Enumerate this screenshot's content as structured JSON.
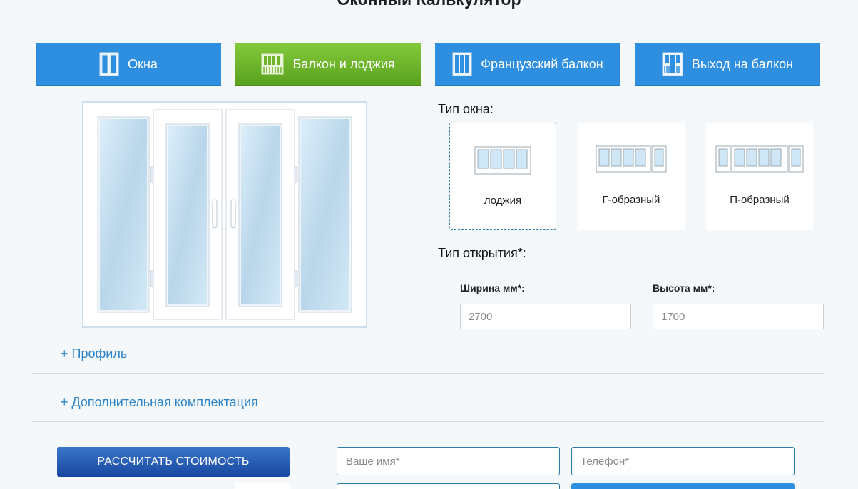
{
  "page": {
    "title": "Оконный Калькулятор"
  },
  "tabs": [
    {
      "label": "Окна",
      "icon": "window-icon",
      "active": false
    },
    {
      "label": "Балкон и лоджия",
      "icon": "balcony-icon",
      "active": true
    },
    {
      "label": "Французский балкон",
      "icon": "french-balcony-icon",
      "active": false
    },
    {
      "label": "Выход на балкон",
      "icon": "balcony-door-icon",
      "active": false
    }
  ],
  "window_type": {
    "title": "Тип окна:",
    "options": [
      {
        "label": "лоджия",
        "selected": true
      },
      {
        "label": "Г-образный",
        "selected": false
      },
      {
        "label": "П-образный",
        "selected": false
      }
    ]
  },
  "opening_type": {
    "title": "Тип открытия",
    "required_mark": "*",
    "suffix": ":"
  },
  "dimensions": {
    "width": {
      "label": "Ширина мм",
      "required_mark": "*",
      "suffix": ":",
      "placeholder": "2700"
    },
    "height": {
      "label": "Высота мм",
      "required_mark": "*",
      "suffix": ":",
      "placeholder": "1700"
    }
  },
  "expanders": {
    "profile": "+ Профиль",
    "extras": "+ Дополнительная комплектация"
  },
  "form": {
    "calculate_button": "РАССЧИТАТЬ СТОИМОСТЬ",
    "name_placeholder": "Ваше имя*",
    "phone_placeholder": "Телефон*"
  },
  "colors": {
    "tab_blue": "#2e8fe0",
    "tab_green": "#5aa21f",
    "link_blue": "#2c84c7",
    "calc_button": "#1848a0"
  }
}
